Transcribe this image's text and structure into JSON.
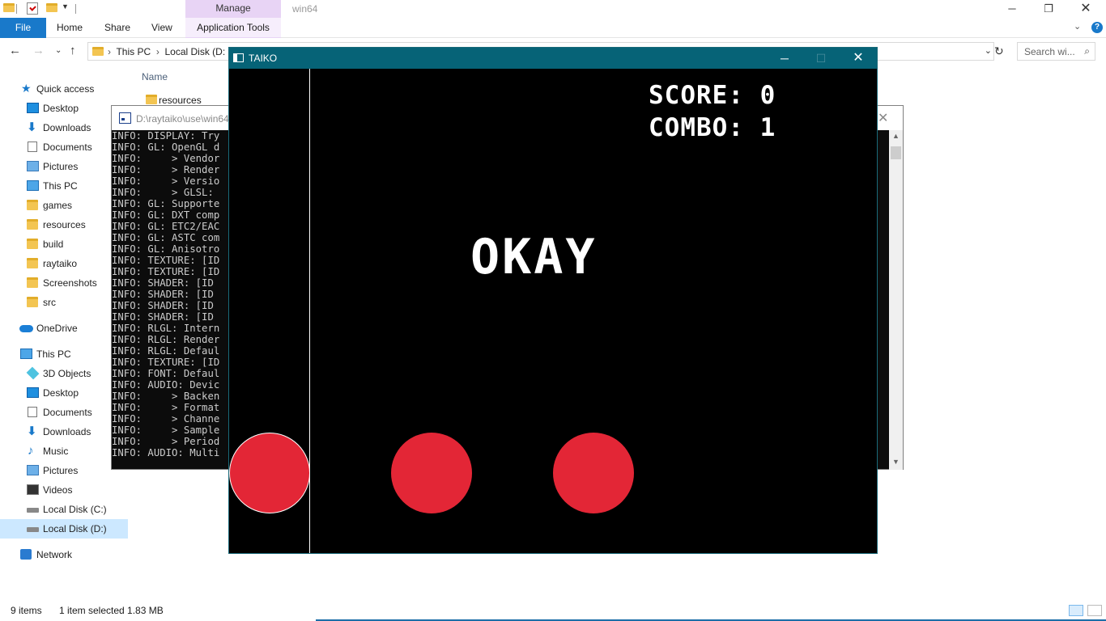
{
  "explorer": {
    "manage_tab": "Manage",
    "window_title": "win64",
    "ribbon": {
      "file": "File",
      "home": "Home",
      "share": "Share",
      "view": "View",
      "app_tools": "Application Tools"
    },
    "address": {
      "crumbs": [
        "This PC",
        "Local Disk (D:"
      ],
      "search_placeholder": "Search wi..."
    },
    "nav": {
      "quick_access": "Quick access",
      "quick_items": [
        "Desktop",
        "Downloads",
        "Documents",
        "Pictures",
        "This PC",
        "games",
        "resources",
        "build",
        "raytaiko",
        "Screenshots",
        "src"
      ],
      "onedrive": "OneDrive",
      "this_pc": "This PC",
      "pc_items": [
        "3D Objects",
        "Desktop",
        "Documents",
        "Downloads",
        "Music",
        "Pictures",
        "Videos",
        "Local Disk (C:)",
        "Local Disk (D:)"
      ],
      "network": "Network"
    },
    "filelist": {
      "column_name": "Name",
      "rows": [
        "resources"
      ]
    },
    "status": {
      "count": "9 items",
      "selection": "1 item selected  1.83 MB"
    }
  },
  "console": {
    "title": "D:\\raytaiko\\use\\win64",
    "lines": [
      "INFO: DISPLAY: Try",
      "INFO: GL: OpenGL d",
      "INFO:     > Vendor",
      "INFO:     > Render",
      "INFO:     > Versio",
      "INFO:     > GLSL: ",
      "INFO: GL: Supporte",
      "INFO: GL: DXT comp",
      "INFO: GL: ETC2/EAC",
      "INFO: GL: ASTC com",
      "INFO: GL: Anisotro",
      "INFO: TEXTURE: [ID",
      "INFO: TEXTURE: [ID",
      "INFO: SHADER: [ID ",
      "INFO: SHADER: [ID ",
      "INFO: SHADER: [ID ",
      "INFO: SHADER: [ID ",
      "INFO: RLGL: Intern",
      "INFO: RLGL: Render",
      "INFO: RLGL: Defaul",
      "INFO: TEXTURE: [ID",
      "INFO: FONT: Defaul",
      "INFO: AUDIO: Devic",
      "INFO:     > Backen",
      "INFO:     > Format",
      "INFO:     > Channe",
      "INFO:     > Sample",
      "INFO:     > Period",
      "INFO: AUDIO: Multi"
    ]
  },
  "game": {
    "title": "TAIKO",
    "score_label": "SCORE: 0",
    "combo_label": "COMBO: 1",
    "judgement": "OKAY",
    "note_color": "#e32636",
    "background": "#000000"
  },
  "colors": {
    "file_tab": "#1979ca",
    "manage_tab": "#e8d4f5",
    "taiko_titlebar": "#066377"
  }
}
